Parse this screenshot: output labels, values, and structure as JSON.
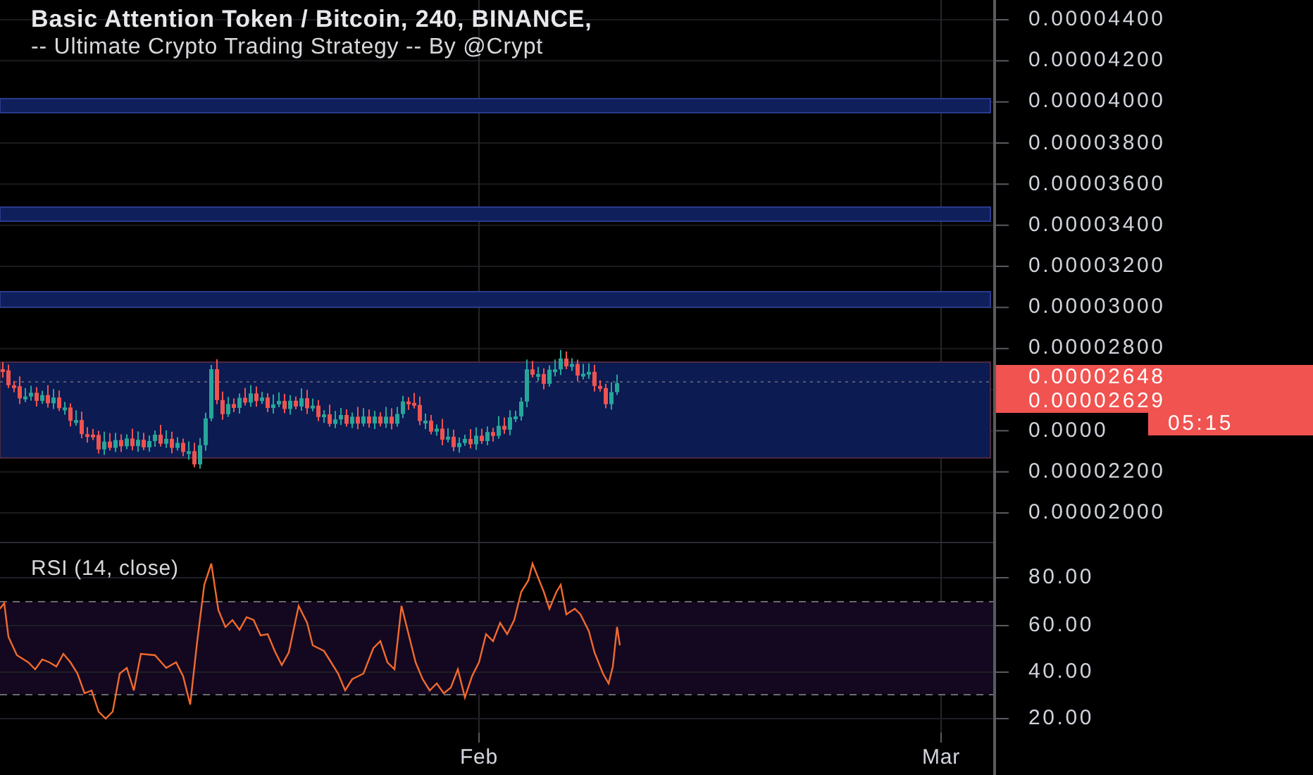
{
  "header": {
    "title": "Basic Attention Token / Bitcoin, 240, BINANCE,",
    "subtitle": "-- Ultimate Crypto Trading Strategy -- By @Crypt"
  },
  "price_axis": {
    "upper_ticks": [
      "0.00004400",
      "0.00004200",
      "0.00004000",
      "0.00003800",
      "0.00003600",
      "0.00003400",
      "0.00003200",
      "0.00003000",
      "0.00002800"
    ],
    "price_tags": [
      "0.00002648",
      "0.00002629"
    ],
    "partly_hidden_tick": "0.0000",
    "countdown": "05:15",
    "lower_ticks": [
      "0.00002200",
      "0.00002000"
    ]
  },
  "rsi": {
    "title": "RSI (14, close)",
    "ticks": [
      "80.00",
      "60.00",
      "40.00",
      "20.00"
    ]
  },
  "time_axis": [
    "Feb",
    "Mar"
  ]
}
